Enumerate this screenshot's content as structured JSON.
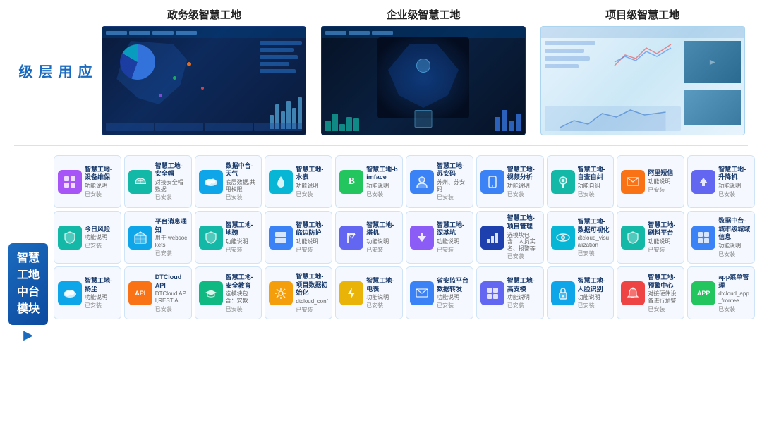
{
  "top": {
    "left_label": [
      "应",
      "用",
      "层",
      "级"
    ],
    "groups": [
      {
        "title": "政务级智慧工地",
        "type": "dark"
      },
      {
        "title": "企业级智慧工地",
        "type": "mid"
      },
      {
        "title": "项目级智慧工地",
        "type": "light"
      }
    ]
  },
  "bottom": {
    "label_lines": [
      "智慧",
      "工地",
      "中台",
      "模块"
    ],
    "arrow": "▶",
    "modules": [
      {
        "name": "智慧工地-设备维保",
        "desc": "功能说明",
        "status": "已安装",
        "icon": "⊞",
        "color": "icon-purple"
      },
      {
        "name": "智慧工地-安全帽",
        "desc": "对接安全帽数据",
        "status": "已安装",
        "icon": "⛑",
        "color": "icon-teal"
      },
      {
        "name": "数据中台-天气",
        "desc": "底层数据,共用权限",
        "status": "已安装",
        "icon": "☁",
        "color": "icon-sky"
      },
      {
        "name": "智慧工地-水表",
        "desc": "功能说明",
        "status": "已安装",
        "icon": "💧",
        "color": "icon-cyan"
      },
      {
        "name": "智慧工地-bimface",
        "desc": "功能说明",
        "status": "已安装",
        "icon": "B",
        "color": "icon-green"
      },
      {
        "name": "智慧工地-苏安码",
        "desc": "苏州、苏安码",
        "status": "已安装",
        "icon": "👤",
        "color": "icon-blue"
      },
      {
        "name": "智慧工地-视频分析",
        "desc": "功能说明",
        "status": "已安装",
        "icon": "📱",
        "color": "icon-blue"
      },
      {
        "name": "智慧工地-自查自纠",
        "desc": "功能自纠",
        "status": "已安装",
        "icon": "📍",
        "color": "icon-teal"
      },
      {
        "name": "阿里短信",
        "desc": "功能说明",
        "status": "已安装",
        "icon": "✉",
        "color": "icon-orange"
      },
      {
        "name": "智慧工地-升降机",
        "desc": "功能说明",
        "status": "已安装",
        "icon": "⬆",
        "color": "icon-indigo"
      },
      {
        "name": "今日风险",
        "desc": "功能说明",
        "status": "已安装",
        "icon": "🛡",
        "color": "icon-teal"
      },
      {
        "name": "平台消息通知",
        "desc": "用于 websockets",
        "status": "已安装",
        "icon": "📦",
        "color": "icon-sky"
      },
      {
        "name": "智慧工地-地磅",
        "desc": "功能说明",
        "status": "已安装",
        "icon": "🛡",
        "color": "icon-teal"
      },
      {
        "name": "智慧工地-临边防护",
        "desc": "功能说明",
        "status": "已安装",
        "icon": "⊟",
        "color": "icon-blue"
      },
      {
        "name": "智慧工地-塔机",
        "desc": "功能说明",
        "status": "已安装",
        "icon": "🏗",
        "color": "icon-indigo"
      },
      {
        "name": "智慧工地-深基坑",
        "desc": "功能说明",
        "status": "已安装",
        "icon": "⬇",
        "color": "icon-violet"
      },
      {
        "name": "智慧工地-项目管理",
        "desc": "选模块包含：人员实名、报警等",
        "status": "已安装",
        "icon": "📊",
        "color": "icon-darkblue"
      },
      {
        "name": "智慧工地-数据可视化",
        "desc": "dtcloud_visualization",
        "status": "已安装",
        "icon": "👁",
        "color": "icon-cyan"
      },
      {
        "name": "智慧工地-刷料平台",
        "desc": "功能说明",
        "status": "已安装",
        "icon": "🛡",
        "color": "icon-teal"
      },
      {
        "name": "数据中台-城市级城域信息",
        "desc": "功能说明",
        "status": "已安装",
        "icon": "⊞",
        "color": "icon-blue"
      },
      {
        "name": "智慧工地-扬尘",
        "desc": "功能说明",
        "status": "已安装",
        "icon": "☁",
        "color": "icon-sky"
      },
      {
        "name": "DTCloud API",
        "desc": "DTCloud API,REST AI",
        "status": "已安装",
        "icon": "API",
        "color": "icon-orange"
      },
      {
        "name": "智慧工地-安全教育",
        "desc": "选模块包含：安教",
        "status": "已安装",
        "icon": "🎓",
        "color": "icon-emerald"
      },
      {
        "name": "智慧工地-项目数据初始化",
        "desc": "dtcloud_conf",
        "status": "已安装",
        "icon": "⚙",
        "color": "icon-amber"
      },
      {
        "name": "智慧工地-电表",
        "desc": "功能说明",
        "status": "已安装",
        "icon": "⚡",
        "color": "icon-yellow"
      },
      {
        "name": "省安监平台数据转发",
        "desc": "功能说明",
        "status": "已安装",
        "icon": "✉",
        "color": "icon-blue"
      },
      {
        "name": "智慧工地-高支模",
        "desc": "功能说明",
        "status": "已安装",
        "icon": "⊞",
        "color": "icon-indigo"
      },
      {
        "name": "智慧工地-人脸识别",
        "desc": "功能说明",
        "status": "已安装",
        "icon": "🔒",
        "color": "icon-sky"
      },
      {
        "name": "智慧工地-预警中心",
        "desc": "对接硬件设备进行预警",
        "status": "已安装",
        "icon": "🔔",
        "color": "icon-red"
      },
      {
        "name": "app菜单管理",
        "desc": "dtcloud_app_frontee",
        "status": "已安装",
        "icon": "APP",
        "color": "icon-green"
      }
    ]
  }
}
